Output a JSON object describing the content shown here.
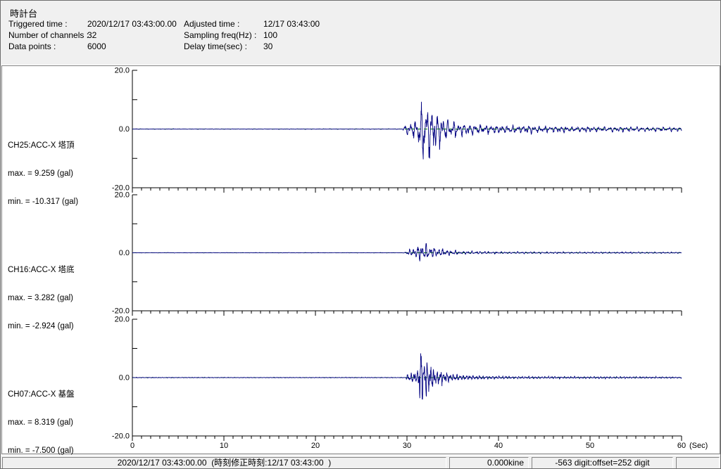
{
  "window": {
    "title": "時計台"
  },
  "header": {
    "title": "時計台",
    "fields": [
      {
        "label": "Triggered time :",
        "value": "2020/12/17 03:43:00.00"
      },
      {
        "label": "Adjusted time :",
        "value": "12/17 03:43:00"
      },
      {
        "label": "Number of channels :",
        "value": "32"
      },
      {
        "label": "Sampling freq(Hz) :",
        "value": "100"
      },
      {
        "label": "Data points :",
        "value": "6000"
      },
      {
        "label": "Delay time(sec) :",
        "value": "30"
      }
    ]
  },
  "colors": {
    "waveform": "#000080",
    "zero_line": "#008000",
    "axis": "#000000",
    "panel_bg": "#ffffff",
    "chrome_bg": "#f0f0f0"
  },
  "time_axis": {
    "ticks": [
      "0",
      "10",
      "20",
      "30",
      "40",
      "50",
      "60"
    ],
    "tick_values": [
      0,
      10,
      20,
      30,
      40,
      50,
      60
    ],
    "minor_step_sec": 1,
    "unit_label": "(Sec)"
  },
  "chart_data": [
    {
      "type": "line",
      "title": "CH25:ACC-X 塔頂",
      "max_label": "max. = 9.259 (gal)",
      "min_label": "min. = -10.317 (gal)",
      "max_gal": 9.259,
      "min_gal": -10.317,
      "ylim": [
        -20,
        20
      ],
      "yticks": [
        {
          "v": 20,
          "label": "20.0"
        },
        {
          "v": 10,
          "label": ""
        },
        {
          "v": 0,
          "label": "0.0"
        },
        {
          "v": -10,
          "label": ""
        },
        {
          "v": -20,
          "label": "-20.0"
        }
      ],
      "xlim": [
        0,
        60
      ],
      "xlabel": "(Sec)",
      "ylabel_unit": "gal",
      "grid": false,
      "signal": {
        "seed": 25,
        "freqs_hz": [
          1.7,
          2.8,
          4.2
        ],
        "onset_sec": 29.6,
        "peak_sec": 31.9,
        "envelope": [
          [
            0,
            0.07
          ],
          [
            29.55,
            0.07
          ],
          [
            29.8,
            1.3
          ],
          [
            30.6,
            2.2
          ],
          [
            31.1,
            3.2
          ],
          [
            31.55,
            8.5
          ],
          [
            32.1,
            10.0
          ],
          [
            32.8,
            7.0
          ],
          [
            33.6,
            4.8
          ],
          [
            34.6,
            3.0
          ],
          [
            36,
            1.9
          ],
          [
            38.5,
            1.3
          ],
          [
            44,
            1.0
          ],
          [
            52,
            0.7
          ],
          [
            60,
            0.55
          ]
        ]
      }
    },
    {
      "type": "line",
      "title": "CH16:ACC-X 塔底",
      "max_label": "max. = 3.282 (gal)",
      "min_label": "min. = -2.924 (gal)",
      "max_gal": 3.282,
      "min_gal": -2.924,
      "ylim": [
        -20,
        20
      ],
      "yticks": [
        {
          "v": 20,
          "label": "20.0"
        },
        {
          "v": 10,
          "label": ""
        },
        {
          "v": 0,
          "label": "0.0"
        },
        {
          "v": -10,
          "label": ""
        },
        {
          "v": -20,
          "label": "-20.0"
        }
      ],
      "xlim": [
        0,
        60
      ],
      "xlabel": "(Sec)",
      "ylabel_unit": "gal",
      "grid": false,
      "signal": {
        "seed": 16,
        "freqs_hz": [
          2.2,
          3.4,
          5.0
        ],
        "onset_sec": 29.7,
        "peak_sec": 31.6,
        "envelope": [
          [
            0,
            0.06
          ],
          [
            29.7,
            0.06
          ],
          [
            30.0,
            0.9
          ],
          [
            30.9,
            1.5
          ],
          [
            31.6,
            3.1
          ],
          [
            32.4,
            2.5
          ],
          [
            33.3,
            1.5
          ],
          [
            34.4,
            0.85
          ],
          [
            36,
            0.5
          ],
          [
            39,
            0.35
          ],
          [
            46,
            0.25
          ],
          [
            60,
            0.2
          ]
        ]
      }
    },
    {
      "type": "line",
      "title": "CH07:ACC-X 基盤",
      "max_label": "max. = 8.319 (gal)",
      "min_label": "min. = -7.500 (gal)",
      "max_gal": 8.319,
      "min_gal": -7.5,
      "ylim": [
        -20,
        20
      ],
      "yticks": [
        {
          "v": 20,
          "label": "20.0"
        },
        {
          "v": 10,
          "label": ""
        },
        {
          "v": 0,
          "label": "0.0"
        },
        {
          "v": -10,
          "label": ""
        },
        {
          "v": -20,
          "label": "-20.0"
        }
      ],
      "xlim": [
        0,
        60
      ],
      "xlabel": "(Sec)",
      "ylabel_unit": "gal",
      "grid": false,
      "signal": {
        "seed": 7,
        "freqs_hz": [
          2.8,
          4.6,
          7.0
        ],
        "onset_sec": 29.9,
        "peak_sec": 31.5,
        "envelope": [
          [
            0,
            0.05
          ],
          [
            29.85,
            0.05
          ],
          [
            30.15,
            0.8
          ],
          [
            31.05,
            1.0
          ],
          [
            31.3,
            2.0
          ],
          [
            31.45,
            8.2
          ],
          [
            31.75,
            4.4
          ],
          [
            32.4,
            2.6
          ],
          [
            33.3,
            1.3
          ],
          [
            34.6,
            0.7
          ],
          [
            36.5,
            0.35
          ],
          [
            42,
            0.18
          ],
          [
            60,
            0.13
          ]
        ]
      }
    }
  ],
  "status_bar": {
    "time_text": "2020/12/17 03:43:00.00  (時刻修正時刻:12/17 03:43:00  )",
    "kine_text": "0.000kine",
    "digit_text": "-563 digit:offset=252 digit",
    "extra_text": ""
  }
}
